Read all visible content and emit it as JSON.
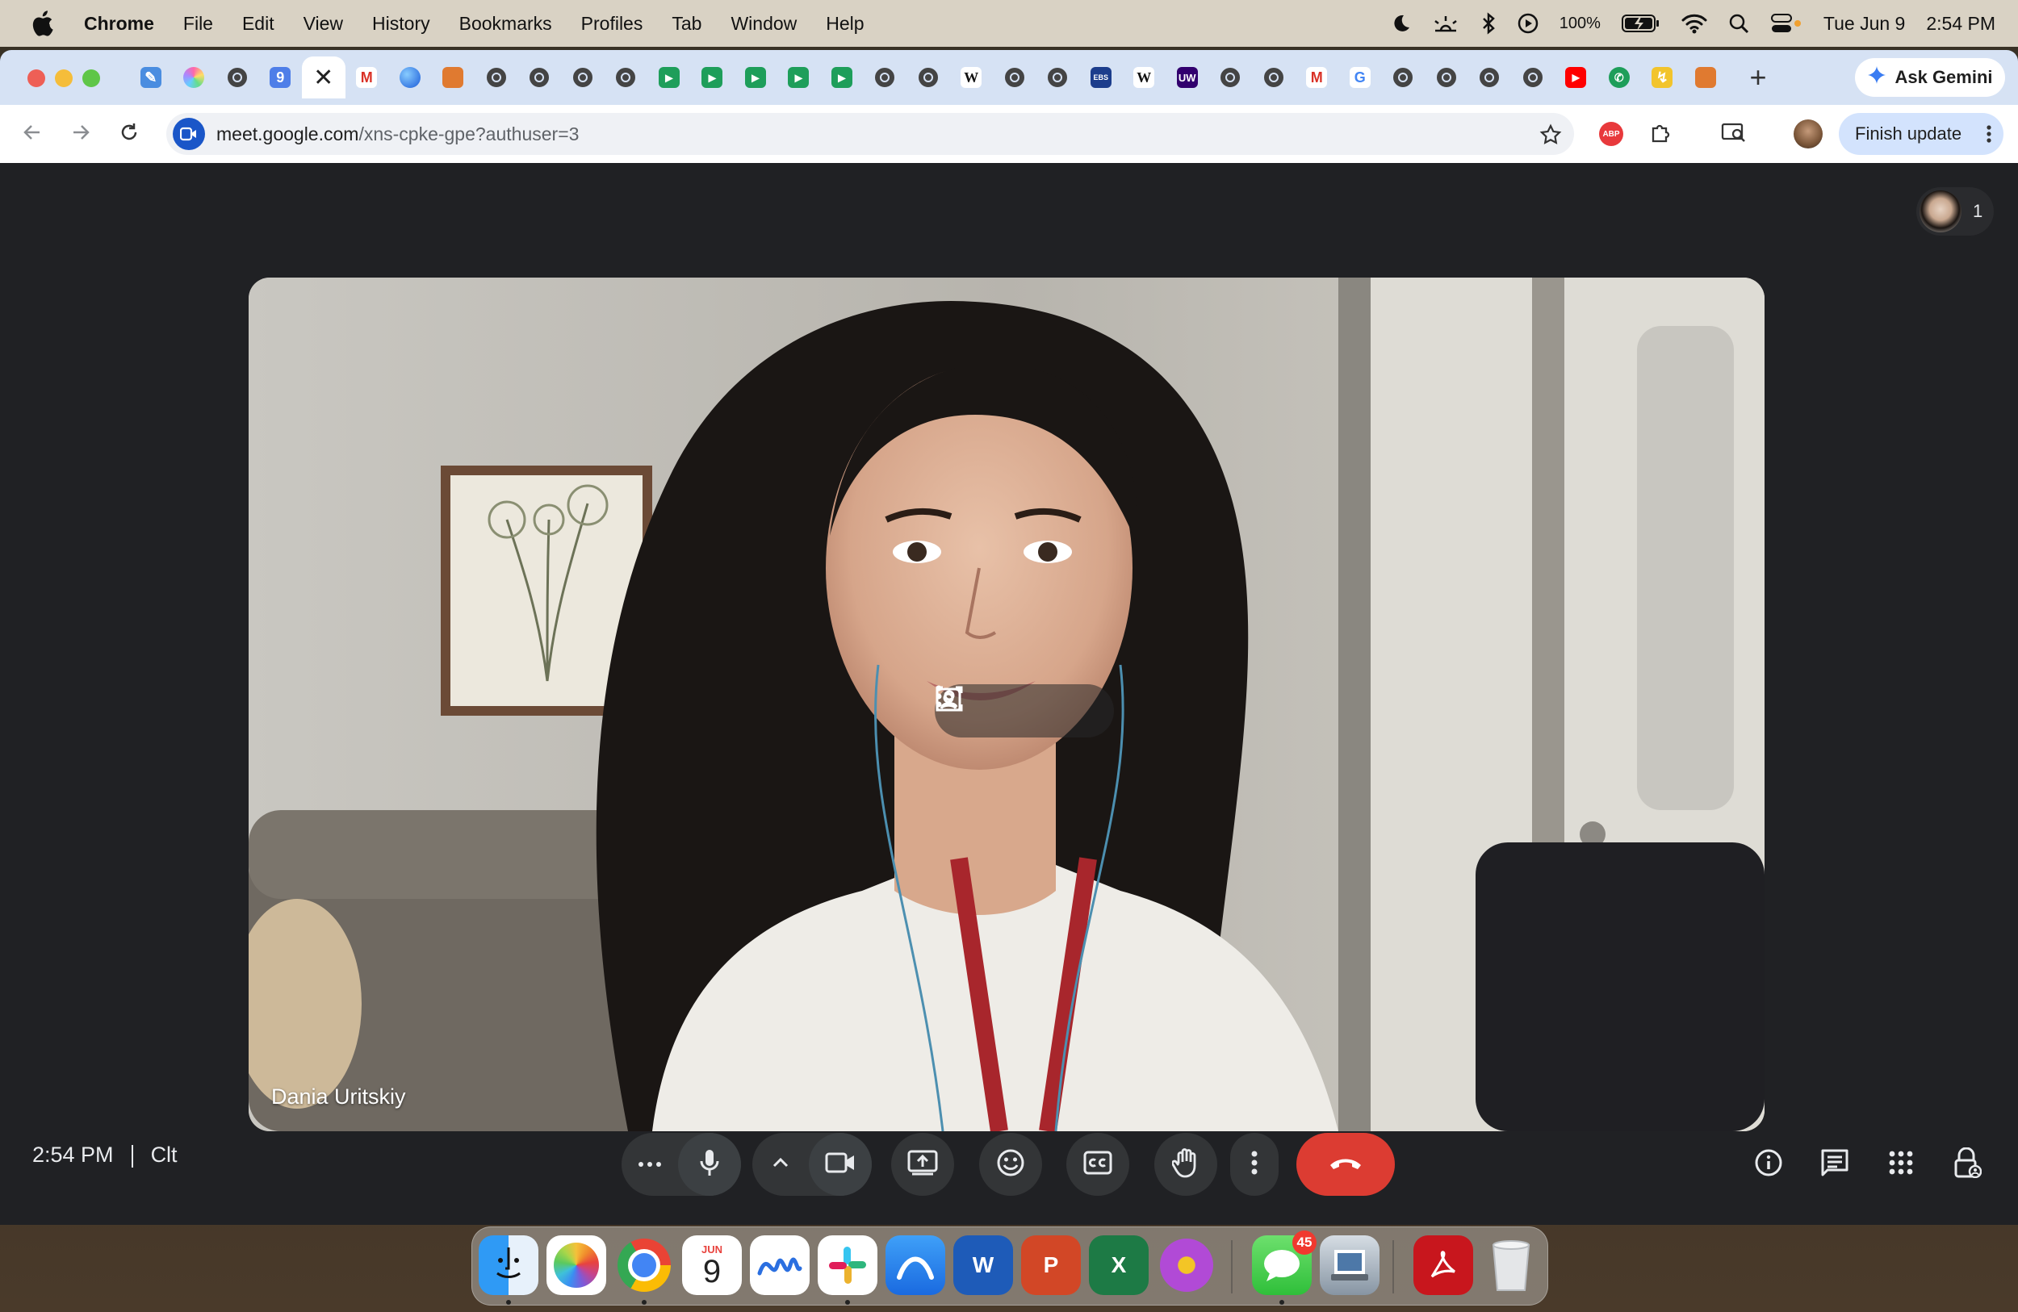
{
  "menubar": {
    "app_name": "Chrome",
    "menus": [
      "File",
      "Edit",
      "View",
      "History",
      "Bookmarks",
      "Profiles",
      "Tab",
      "Window",
      "Help"
    ],
    "battery": "100%",
    "date": "Tue Jun 9",
    "time": "2:54 PM"
  },
  "tabs": {
    "favicons": [
      "edit-icon",
      "color-wheel-icon",
      "globe-icon",
      "docs-icon",
      "close-icon",
      "gmail-icon",
      "blue-globe-icon",
      "orange-icon",
      "globe-icon",
      "globe-icon",
      "globe-icon",
      "globe-icon",
      "meet-icon",
      "meet-icon",
      "meet-icon",
      "meet-icon",
      "meet-icon",
      "globe-icon",
      "globe-icon",
      "wikipedia-icon",
      "globe-icon",
      "globe-icon",
      "ebsco-icon",
      "wikipedia-icon",
      "uw-icon",
      "globe-icon",
      "globe-icon",
      "gmail-icon",
      "google-icon",
      "globe-icon",
      "globe-icon",
      "globe-icon",
      "globe-icon",
      "youtube-icon",
      "phone-icon",
      "yellow-icon",
      "orange-icon"
    ],
    "wiki_letter": "W",
    "uw_letter": "UW",
    "ebsco_letter": "EBS",
    "google_letter": "G",
    "gmail_letter": "M",
    "new_tab": "+",
    "ask_gemini": "Ask Gemini"
  },
  "toolbar": {
    "url_host": "meet.google.com",
    "url_path": "/xns-cpke-gpe?authuser=3",
    "abp_label": "ABP",
    "finish_update": "Finish update"
  },
  "meet": {
    "participant_count": "1",
    "participant_name": "Dania Uritskiy",
    "time": "2:54 PM",
    "meeting_code": "Clt"
  },
  "dock": {
    "calendar_month": "JUN",
    "calendar_day": "9",
    "messages_badge": "45",
    "apps": [
      "finder-icon",
      "photos-icon",
      "chrome-icon",
      "calendar-icon",
      "freeform-icon",
      "slack-icon",
      "app-store-icon",
      "word-icon",
      "powerpoint-icon",
      "excel-icon",
      "flower-icon",
      "messages-icon",
      "preview-icon",
      "acrobat-icon",
      "trash-icon"
    ],
    "word_letter": "W",
    "powerpoint_letter": "P",
    "excel_letter": "X"
  },
  "colors": {
    "meet_bg": "#202124",
    "end_call": "#dc3c32",
    "tabstrip": "#d6e2f4",
    "finish_update_bg": "#d3e3fd"
  }
}
